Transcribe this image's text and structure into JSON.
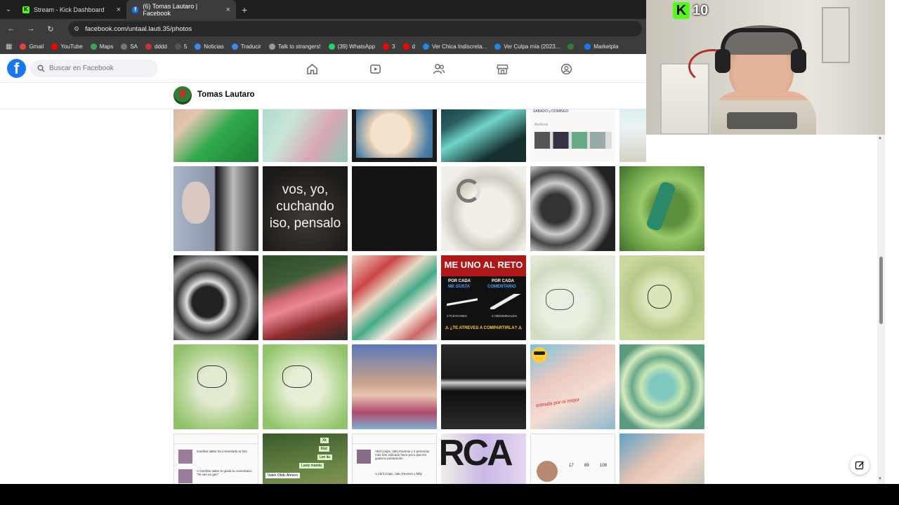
{
  "browser": {
    "tabs": [
      {
        "title": "Stream - Kick Dashboard",
        "active": false
      },
      {
        "title": "(6) Tomas Lautaro | Facebook",
        "active": true
      }
    ],
    "new_tab_symbol": "+",
    "close_symbol": "×",
    "url": "facebook.com/untaal.lauti.35/photos",
    "bookmarks": [
      {
        "label": "Gmail",
        "color": "#ea4335"
      },
      {
        "label": "YouTube",
        "color": "#ff0000"
      },
      {
        "label": "Maps",
        "color": "#34a853"
      },
      {
        "label": "SA",
        "color": "#777777"
      },
      {
        "label": "dddd",
        "color": "#cc3333"
      },
      {
        "label": "5",
        "color": "#555555"
      },
      {
        "label": "Noticias",
        "color": "#4285f4"
      },
      {
        "label": "Traducir",
        "color": "#4285f4"
      },
      {
        "label": "Talk to strangers!",
        "color": "#999999"
      },
      {
        "label": "(39) WhatsApp",
        "color": "#25d366"
      },
      {
        "label": "3",
        "color": "#ff0000"
      },
      {
        "label": "d",
        "color": "#ff0000"
      },
      {
        "label": "Ver Chica Indiscreta...",
        "color": "#1e88e5"
      },
      {
        "label": "Ver Culpa mía (2023...",
        "color": "#1e88e5"
      },
      {
        "label": "",
        "color": "#2e7d32"
      },
      {
        "label": "Marketpla",
        "color": "#1877f2"
      }
    ]
  },
  "facebook": {
    "logo": "f",
    "search_placeholder": "Buscar en Facebook",
    "nav_icons": [
      "home-icon",
      "video-icon",
      "friends-icon",
      "marketplace-icon",
      "gaming-icon"
    ],
    "profile_name": "Tomas Lautaro"
  },
  "photos": {
    "text_vos": "vos, yo,\ncuchando\niso, pensalo",
    "reto_title": "ME UNO AL RETO",
    "reto_left_top": "POR CADA",
    "reto_left_bottom": "ME GUSTA",
    "reto_right_top": "POR CADA",
    "reto_right_bottom": "COMENTARIO",
    "reto_left_count": "3 FLEXIONES",
    "reto_right_count": "3 ABDOMINALES",
    "reto_question": "⚠ ¿TE ATREVES A COMPARTIRLA? ⚠",
    "red_caption": "estrada por ni mejor",
    "rca_text": "RCA",
    "chat_lines": [
      "Xk",
      "Kkd",
      "Lee itu",
      "Lauty manda",
      "Valen Obdc Ahreno"
    ],
    "notif_lines": [
      "Garribia Valen ha comentado tu foto",
      "A Garribia Valen le gusta tu comentario: \"Te veo en gen\""
    ],
    "notif2_lines": [
      "Abril Cejas, Valu Pavesio y 2 personas más han indicado hace poco que les gusta tu publicación",
      "A Abril Cejas, Valu Pavesio y Mily"
    ],
    "stats": [
      "17",
      "89",
      "108"
    ],
    "archivos_label": "Archivos",
    "top_caption": "SABADO y DOMINGO"
  },
  "stream": {
    "viewer_count": "10",
    "platform_icon": "kick-icon"
  },
  "colors": {
    "fb_blue": "#1877f2",
    "kick_green": "#53fc18",
    "chrome_dark": "#3c3c3c"
  }
}
